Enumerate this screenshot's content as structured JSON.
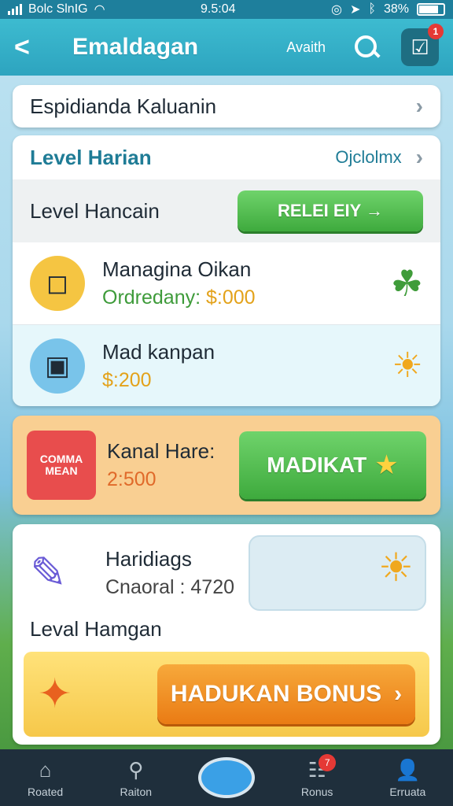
{
  "status": {
    "carrier": "Bolc SlnIG",
    "time": "9.5:04",
    "battery": "38%"
  },
  "header": {
    "title": "Emaldagan",
    "link": "Avaith",
    "badge": "1"
  },
  "row1": {
    "label": "Espidianda Kaluanin"
  },
  "row2": {
    "label": "Level Harian",
    "value": "Ojclolmx"
  },
  "row3": {
    "label": "Level Hancain",
    "button": "RELEI EIY →"
  },
  "item1": {
    "name": "Managina Oikan",
    "sub_label": "Ordredany:",
    "sub_value": "$:000"
  },
  "item2": {
    "name": "Mad kanpan",
    "sub_value": "$:200"
  },
  "promo": {
    "icon_text": "COMMA MEAN",
    "name": "Kanal Hare:",
    "value": "2:500",
    "button": "MADIKAT"
  },
  "feature": {
    "name": "Haridiags",
    "sub": "Cnaoral : 4720",
    "caption": "Leval Hamgan"
  },
  "bonus": {
    "button": "HADUKAN BONUS"
  },
  "nav": {
    "home": "Roated",
    "search": "Raiton",
    "bonus": "Ronus",
    "profile": "Erruata",
    "bonus_badge": "7"
  },
  "colors": {
    "header": "#2da4bf",
    "green": "#3eaa3d",
    "orange": "#f0901e",
    "nav": "#1f2f3c"
  }
}
